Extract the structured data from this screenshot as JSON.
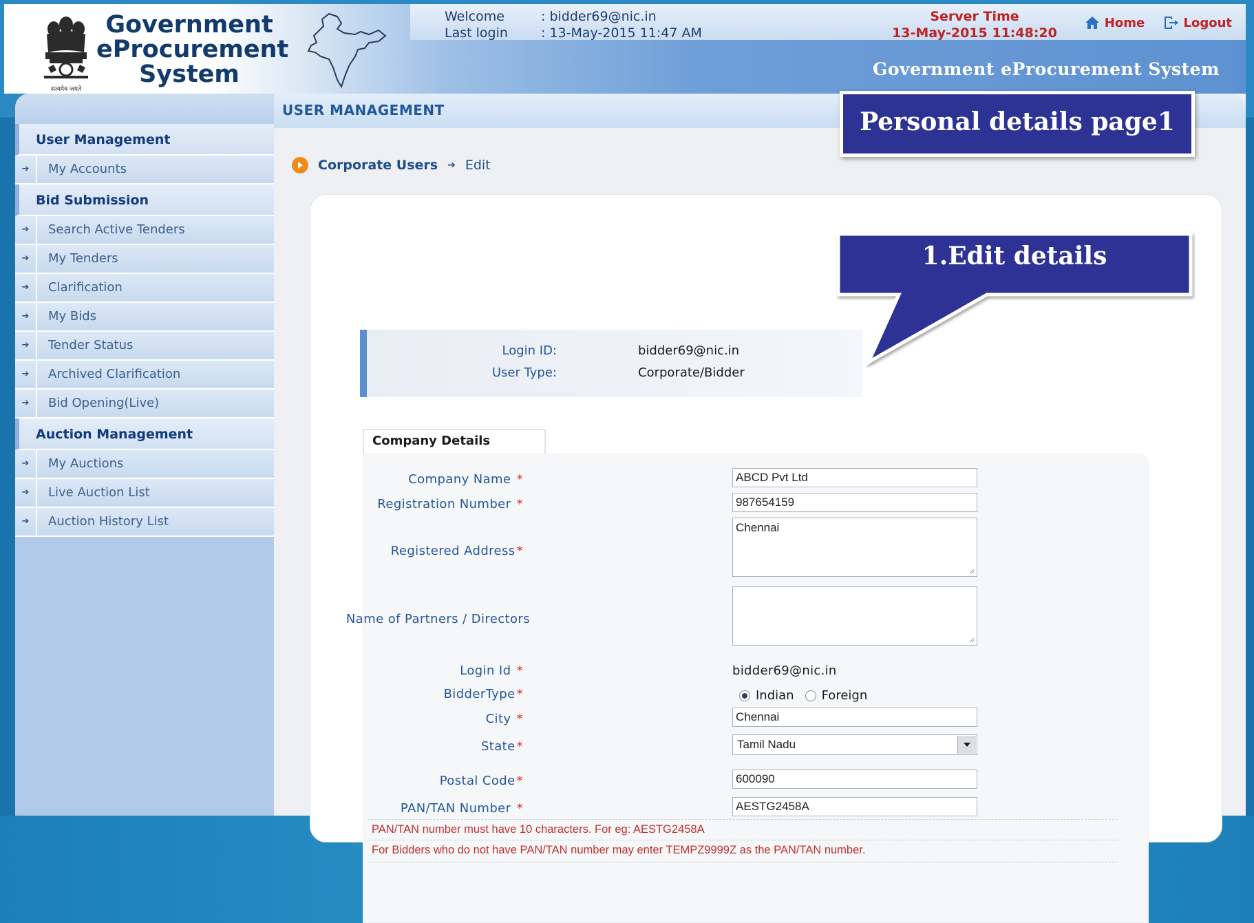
{
  "header": {
    "logo_line1": "Government",
    "logo_line2": "eProcurement",
    "logo_line3": "System",
    "emblem_caption": "सत्यमेव जयते",
    "welcome_label": "Welcome",
    "welcome_value": ": bidder69@nic.in",
    "lastlogin_label": "Last login",
    "lastlogin_value": ": 13-May-2015 11:47 AM",
    "server_time_label": "Server Time",
    "server_time_value": "13-May-2015 11:48:20",
    "home_label": "Home",
    "logout_label": "Logout",
    "banner_title": "Government eProcurement System"
  },
  "sidebar": {
    "sections": [
      {
        "title": "User Management",
        "items": [
          "My Accounts"
        ]
      },
      {
        "title": "Bid Submission",
        "items": [
          "Search Active Tenders",
          "My Tenders",
          "Clarification",
          "My Bids",
          "Tender Status",
          "Archived Clarification",
          "Bid Opening(Live)"
        ]
      },
      {
        "title": "Auction Management",
        "items": [
          "My Auctions",
          "Live Auction List",
          "Auction History List"
        ]
      }
    ]
  },
  "main": {
    "title": "USER MANAGEMENT",
    "breadcrumb": {
      "link": "Corporate Users",
      "current": "Edit"
    },
    "login_info": {
      "login_id_label": "Login ID:",
      "login_id_value": "bidder69@nic.in",
      "user_type_label": "User Type:",
      "user_type_value": "Corporate/Bidder"
    },
    "company_tab": "Company Details",
    "form": {
      "company_name_label": "Company Name",
      "company_name_value": "ABCD Pvt Ltd",
      "registration_number_label": "Registration Number",
      "registration_number_value": "987654159",
      "registered_address_label": "Registered Address",
      "registered_address_value": "Chennai",
      "partners_label": "Name of Partners / Directors",
      "partners_value": "",
      "login_id_label": "Login Id",
      "login_id_value": "bidder69@nic.in",
      "bidder_type_label": "BidderType",
      "bidder_type_options": [
        "Indian",
        "Foreign"
      ],
      "bidder_type_selected": "Indian",
      "city_label": "City",
      "city_value": "Chennai",
      "state_label": "State",
      "state_value": "Tamil Nadu",
      "postal_code_label": "Postal Code",
      "postal_code_value": "600090",
      "pan_label": "PAN/TAN Number",
      "pan_value": "AESTG2458A",
      "note1": "PAN/TAN number must have 10 characters. For eg: AESTG2458A",
      "note2": "For Bidders who do not have PAN/TAN number may enter TEMPZ9999Z as the PAN/TAN number."
    }
  },
  "callouts": {
    "title_callout": "Personal details page1",
    "edit_callout": "1.Edit details"
  },
  "colors": {
    "accent_blue": "#2d3394",
    "link_blue": "#1f4f8c",
    "required_red": "#d3272b",
    "server_time_red": "#c02323"
  }
}
